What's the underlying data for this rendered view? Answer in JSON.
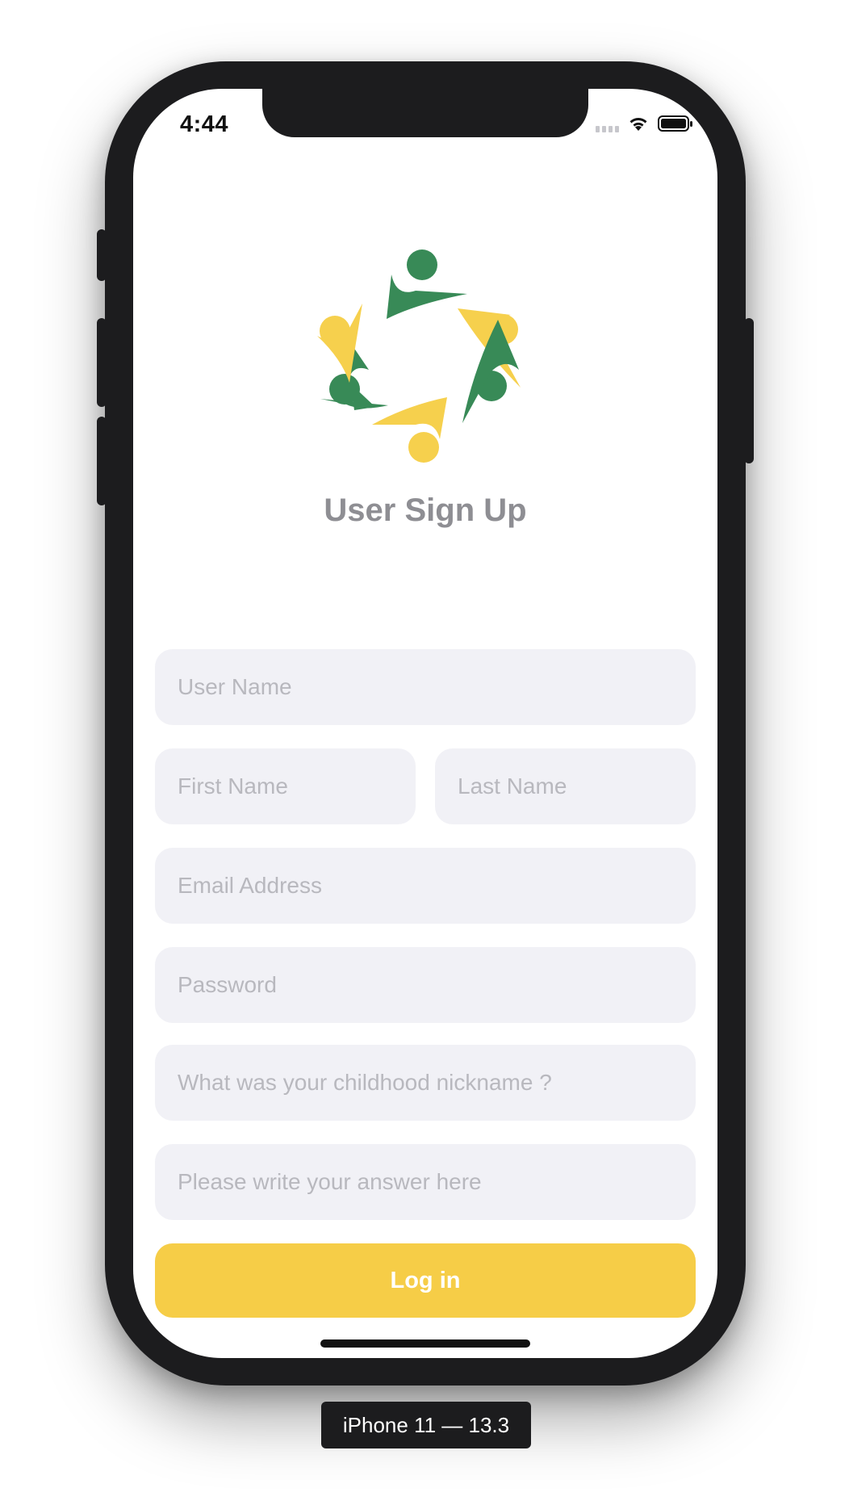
{
  "status_bar": {
    "time": "4:44"
  },
  "form": {
    "title": "User Sign Up",
    "username_placeholder": "User Name",
    "firstname_placeholder": "First Name",
    "lastname_placeholder": "Last Name",
    "email_placeholder": "Email Address",
    "password_placeholder": "Password",
    "security_question_placeholder": "What was your childhood nickname ?",
    "answer_placeholder": "Please write your answer here",
    "submit_label": "Log in"
  },
  "device_label": "iPhone 11 — 13.3",
  "colors": {
    "accent_yellow": "#f6cd47",
    "logo_green": "#388a57",
    "logo_yellow": "#f6d04d",
    "field_bg": "#f1f1f6",
    "title_gray": "#8e8e93"
  }
}
